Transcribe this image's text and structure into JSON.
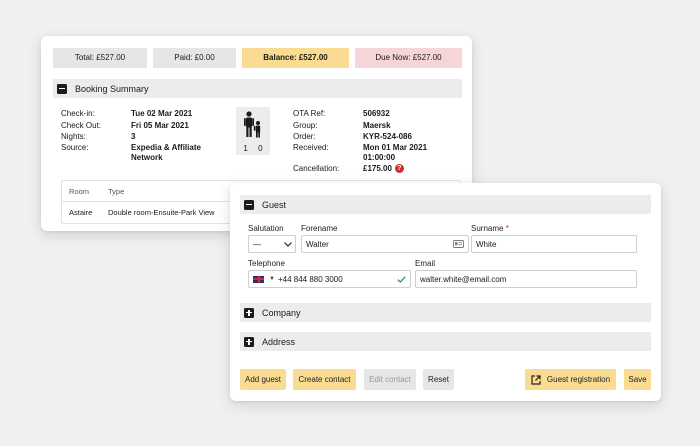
{
  "totals": {
    "total": "Total: £527.00",
    "paid": "Paid: £0.00",
    "balance": "Balance: £527.00",
    "due_now": "Due Now: £527.00"
  },
  "booking_summary": {
    "title": "Booking Summary",
    "left": [
      {
        "label": "Check-in:",
        "value": "Tue 02 Mar 2021"
      },
      {
        "label": "Check Out:",
        "value": "Fri 05 Mar 2021"
      },
      {
        "label": "Nights:",
        "value": "3"
      },
      {
        "label": "Source:",
        "value": "Expedia & Affiliate Network"
      }
    ],
    "occupancy": {
      "adults": "1",
      "children": "0"
    },
    "right": [
      {
        "label": "OTA Ref:",
        "value": "506932"
      },
      {
        "label": "Group:",
        "value": "Maersk"
      },
      {
        "label": "Order:",
        "value": "KYR-524-086"
      },
      {
        "label": "Received:",
        "value": "Mon 01 Mar 2021 01:00:00"
      },
      {
        "label": "Cancellation:",
        "value": "£175.00"
      }
    ],
    "help_icon": "?",
    "rooms_table": {
      "headers": [
        "Room",
        "Type"
      ],
      "rows": [
        [
          "Astaire",
          "Double room-Ensuite-Park View"
        ]
      ]
    }
  },
  "guest": {
    "title": "Guest",
    "salutation": {
      "label": "Salutation",
      "value": "—"
    },
    "forename": {
      "label": "Forename",
      "value": "Walter"
    },
    "surname": {
      "label": "Surname",
      "required_mark": "*",
      "value": "White"
    },
    "telephone": {
      "label": "Telephone",
      "value": "+44 844 880 3000",
      "country": "GB"
    },
    "email": {
      "label": "Email",
      "value": "walter.white@email.com"
    }
  },
  "sections": {
    "company": "Company",
    "address": "Address"
  },
  "buttons": {
    "add_guest": "Add guest",
    "create_contact": "Create contact",
    "edit_contact": "Edit contact",
    "reset": "Reset",
    "guest_registration": "Guest registration",
    "save": "Save"
  },
  "icons": {
    "collapse": "minus-square-icon",
    "expand": "plus-square-icon",
    "person": "adult-child-icon",
    "contact_card": "id-card-icon",
    "valid": "check-icon",
    "external": "external-link-icon"
  },
  "colors": {
    "accent_yellow": "#f9dc92",
    "due_pink": "#f5d5d7",
    "neutral_grey": "#e6e6e6",
    "error_red": "#d12b2b",
    "valid_green": "#2e9e4f"
  }
}
